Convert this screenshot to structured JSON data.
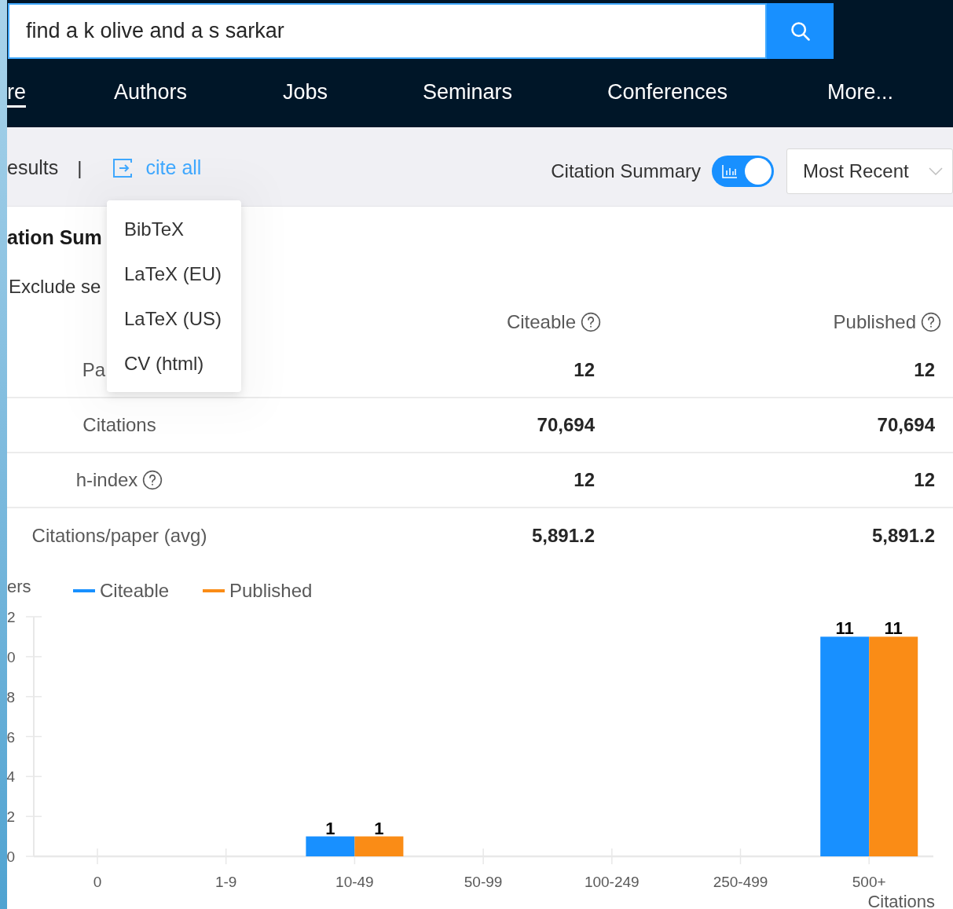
{
  "search": {
    "value": "find a k olive and a s sarkar"
  },
  "nav": [
    {
      "label": "re",
      "selected": true
    },
    {
      "label": "Authors",
      "selected": false
    },
    {
      "label": "Jobs",
      "selected": false
    },
    {
      "label": "Seminars",
      "selected": false
    },
    {
      "label": "Conferences",
      "selected": false
    },
    {
      "label": "More...",
      "selected": false
    }
  ],
  "toolbar": {
    "results": "esults",
    "separator": "|",
    "cite_all": "cite all",
    "citation_summary": {
      "label": "Citation Summary",
      "on": true
    },
    "sort": {
      "value": "Most Recent"
    }
  },
  "cite_menu": [
    "BibTeX",
    "LaTeX (EU)",
    "LaTeX (US)",
    "CV (html)"
  ],
  "summary": {
    "title": "ation Sum",
    "exclude": "Exclude se",
    "columns": [
      {
        "label": "Citeable",
        "help": true
      },
      {
        "label": "Published",
        "help": true
      }
    ],
    "rows": [
      {
        "label": "Pa",
        "help": false,
        "citeable": "12",
        "published": "12"
      },
      {
        "label": "Citations",
        "help": false,
        "citeable": "70,694",
        "published": "70,694"
      },
      {
        "label": "h-index",
        "help": true,
        "citeable": "12",
        "published": "12"
      },
      {
        "label": "Citations/paper (avg)",
        "help": false,
        "citeable": "5,891.2",
        "published": "5,891.2"
      }
    ],
    "chart_data": {
      "type": "bar",
      "ylabel": "ers",
      "xlabel": "Citations",
      "categories": [
        "0",
        "1-9",
        "10-49",
        "50-99",
        "100-249",
        "250-499",
        "500+"
      ],
      "series": [
        {
          "name": "Citeable",
          "color": "#1890ff",
          "values": [
            0,
            0,
            1,
            0,
            0,
            0,
            11
          ],
          "value_labels": [
            null,
            null,
            "1",
            null,
            null,
            null,
            "11"
          ]
        },
        {
          "name": "Published",
          "color": "#fa8c16",
          "values": [
            0,
            0,
            1,
            0,
            0,
            0,
            11
          ],
          "value_labels": [
            null,
            null,
            "1",
            null,
            null,
            null,
            "11"
          ]
        }
      ],
      "legend": "top",
      "ylim": [
        0,
        12
      ],
      "yticks": [
        0,
        2,
        4,
        6,
        8
      ]
    },
    "chart_cut_tick_labels": [
      "2",
      "0"
    ]
  }
}
